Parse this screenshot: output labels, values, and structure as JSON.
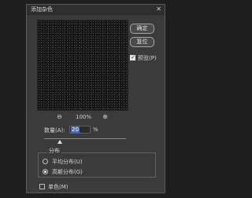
{
  "window": {
    "title": "添加杂色",
    "close_glyph": "✕"
  },
  "buttons": {
    "ok_label": "确定",
    "reset_label": "复位"
  },
  "preview_toggle": {
    "label": "预览(P)",
    "checked": true
  },
  "zoom": {
    "minus_icon": "zoom-out-icon",
    "plus_icon": "zoom-in-icon",
    "value": "100%"
  },
  "amount": {
    "label": "数量(A):",
    "value": "20",
    "unit": "%"
  },
  "distribution": {
    "group_label": "分布",
    "options": [
      {
        "label": "平均分布(U)",
        "selected": false
      },
      {
        "label": "高斯分布(G)",
        "selected": true
      }
    ]
  },
  "monochromatic": {
    "label": "单色(M)",
    "checked": false
  },
  "colors": {
    "dialog_bg": "#3b3b3b",
    "selection": "#3f6ec8"
  }
}
